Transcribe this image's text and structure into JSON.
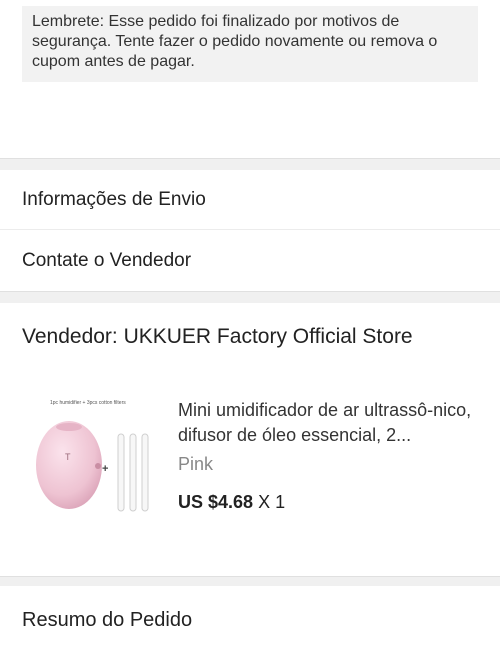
{
  "notice": {
    "text": "Lembrete: Esse pedido foi finalizado por motivos de segurança. Tente fazer o pedido novamente ou remova o cupom antes de pagar."
  },
  "links": {
    "shipping_info": "Informações de Envio",
    "contact_seller": "Contate o Vendedor"
  },
  "seller": {
    "title": "Vendedor: UKKUER Factory Official Store"
  },
  "product": {
    "image_caption": "1pc humidifier + 3pcs cotton filters",
    "name": "Mini umidificador de ar ultrassô-nico, difusor de óleo essencial, 2...",
    "variant": "Pink",
    "price": "US $4.68",
    "quantity": "X 1"
  },
  "summary": {
    "title": "Resumo do Pedido"
  }
}
